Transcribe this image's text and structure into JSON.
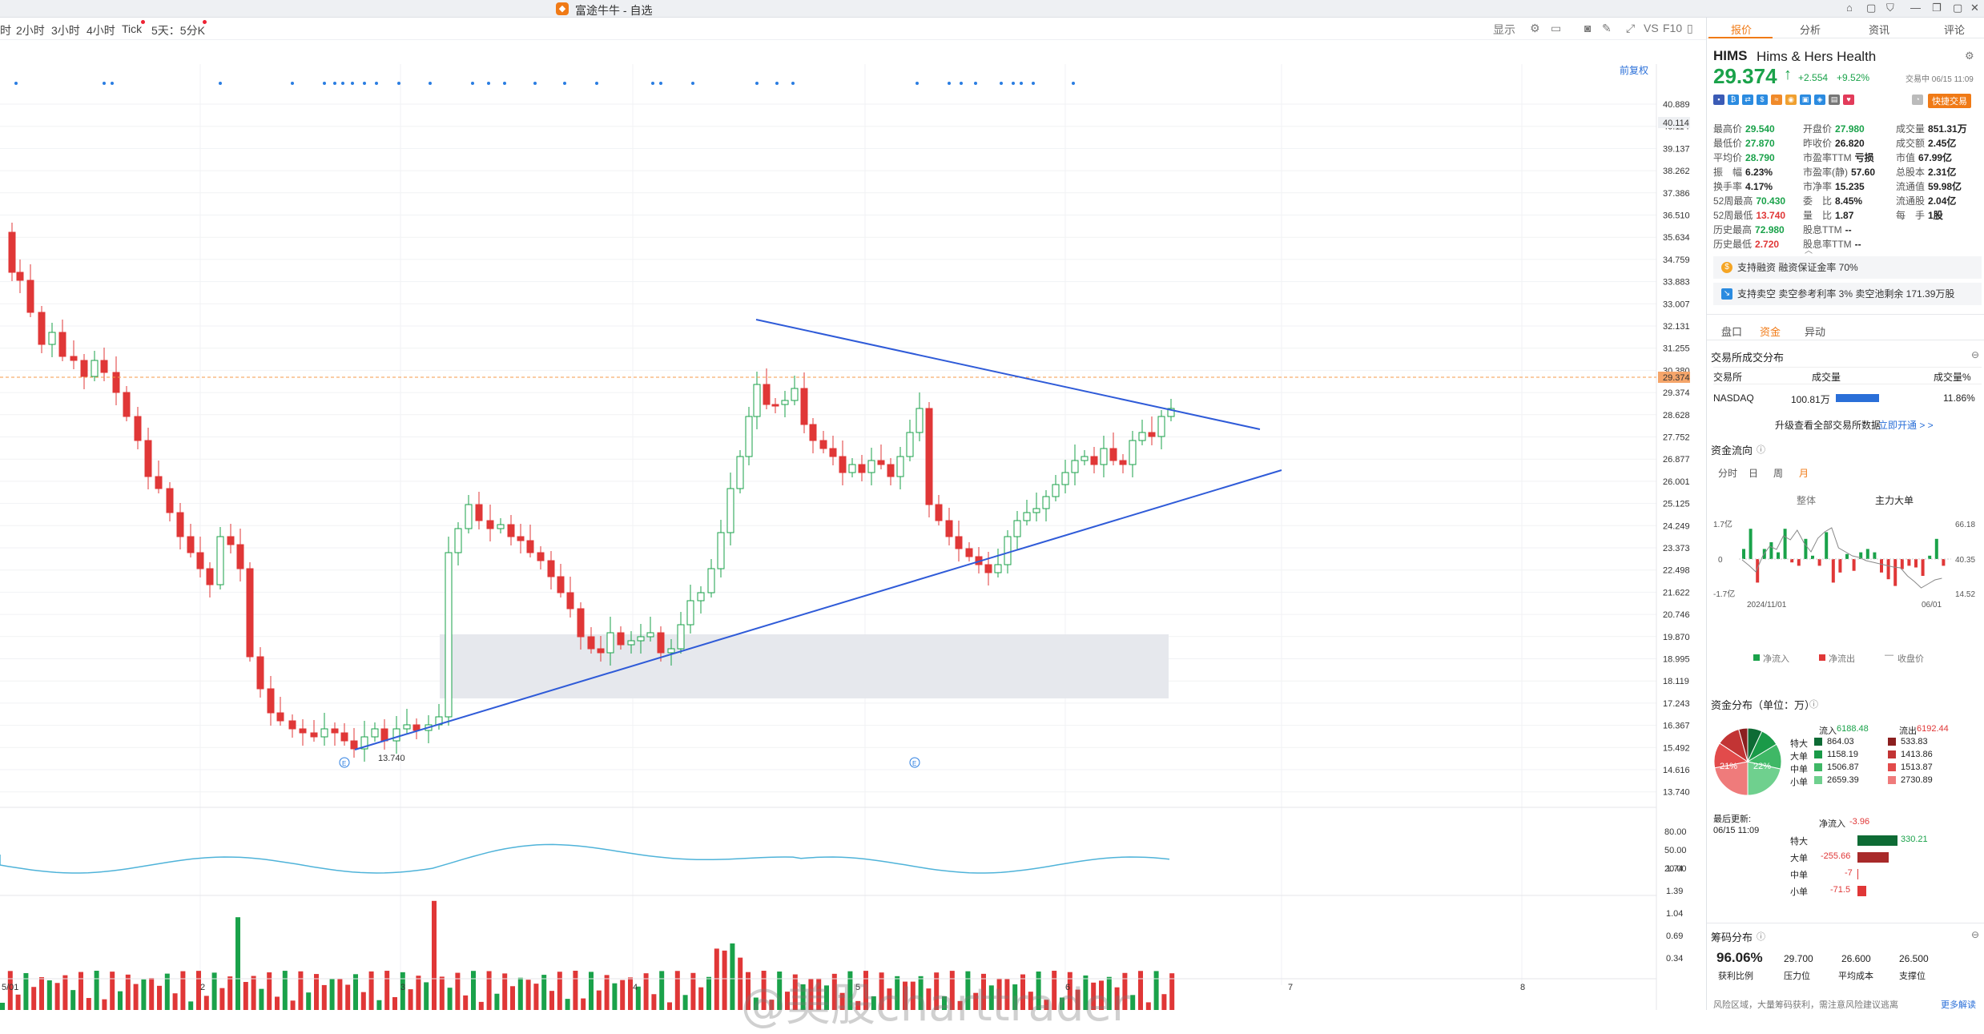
{
  "app": {
    "title": "富途牛牛 - 自选"
  },
  "toolbar": {
    "timeframes": [
      "时",
      "2小时",
      "3小时",
      "4小时",
      "Tick",
      "5天：5分K"
    ],
    "right_items": [
      "显示",
      "VS",
      "F10"
    ],
    "restore_label": "前复权"
  },
  "chart": {
    "price_ticks": [
      "40.889",
      "40.114",
      "39.137",
      "38.262",
      "37.386",
      "36.510",
      "35.634",
      "34.759",
      "33.883",
      "33.007",
      "32.131",
      "31.255",
      "30.380",
      "29.374",
      "28.628",
      "27.752",
      "26.877",
      "26.001",
      "25.125",
      "24.249",
      "23.373",
      "22.498",
      "21.622",
      "20.746",
      "19.870",
      "18.995",
      "18.119",
      "17.243",
      "16.367",
      "15.492",
      "14.616",
      "13.740"
    ],
    "current_price_label": "29.374",
    "top_price_label": "40.114",
    "low_annotation": "13.740",
    "event_marker": "E",
    "osc_ticks": [
      "80.00",
      "50.00",
      "20.00"
    ],
    "vol_ticks": [
      "1.74",
      "1.39",
      "1.04",
      "0.69",
      "0.34"
    ],
    "date_labels": [
      "5/01",
      "2",
      "3",
      "4",
      "5",
      "6",
      "7",
      "8"
    ],
    "watermark": "@美股charttrader"
  },
  "quote": {
    "tabs": [
      "报价",
      "分析",
      "资讯",
      "评论"
    ],
    "symbol": "HIMS",
    "name": "Hims & Hers Health",
    "price": "29.374",
    "arrow": "↑",
    "change": "+2.554",
    "change_pct": "+9.52%",
    "status": "交易中 06/15 11:09",
    "quick_trade": "快捷交易",
    "col1": [
      {
        "k": "最高价",
        "v": "29.540",
        "c": "green"
      },
      {
        "k": "最低价",
        "v": "27.870",
        "c": "green"
      },
      {
        "k": "平均价",
        "v": "28.790",
        "c": "green"
      },
      {
        "k": "振　幅",
        "v": "6.23%",
        "c": ""
      },
      {
        "k": "换手率",
        "v": "4.17%",
        "c": ""
      },
      {
        "k": "52周最高",
        "v": "70.430",
        "c": "green"
      },
      {
        "k": "52周最低",
        "v": "13.740",
        "c": "red"
      },
      {
        "k": "历史最高",
        "v": "72.980",
        "c": "green"
      },
      {
        "k": "历史最低",
        "v": "2.720",
        "c": "red"
      }
    ],
    "col2": [
      {
        "k": "开盘价",
        "v": "27.980",
        "c": "green"
      },
      {
        "k": "昨收价",
        "v": "26.820",
        "c": ""
      },
      {
        "k": "市盈率TTM",
        "v": "亏损",
        "c": ""
      },
      {
        "k": "市盈率(静)",
        "v": "57.60",
        "c": ""
      },
      {
        "k": "市净率",
        "v": "15.235",
        "c": ""
      },
      {
        "k": "委　比",
        "v": "8.45%",
        "c": ""
      },
      {
        "k": "量　比",
        "v": "1.87",
        "c": ""
      },
      {
        "k": "股息TTM",
        "v": "--",
        "c": ""
      },
      {
        "k": "股息率TTM",
        "v": "--",
        "c": ""
      }
    ],
    "col3": [
      {
        "k": "成交量",
        "v": "851.31万",
        "c": ""
      },
      {
        "k": "成交额",
        "v": "2.45亿",
        "c": ""
      },
      {
        "k": "市值",
        "v": "67.99亿",
        "c": ""
      },
      {
        "k": "总股本",
        "v": "2.31亿",
        "c": ""
      },
      {
        "k": "流通值",
        "v": "59.98亿",
        "c": ""
      },
      {
        "k": "流通股",
        "v": "2.04亿",
        "c": ""
      },
      {
        "k": "每　手",
        "v": "1股",
        "c": ""
      }
    ],
    "margin_info": "支持融资  融资保证金率 70%",
    "short_info": "支持卖空  卖空参考利率 3%  卖空池剩余 171.39万股"
  },
  "capital": {
    "tabs": [
      "盘口",
      "资金",
      "异动"
    ],
    "exchange_title": "交易所成交分布",
    "exchange_headers": [
      "交易所",
      "成交量",
      "成交量%"
    ],
    "exchange_row": {
      "name": "NASDAQ",
      "volume": "100.81万",
      "pct": "11.86%"
    },
    "upgrade_text": "升级查看全部交易所数据",
    "upgrade_link": "立即开通 > >",
    "flow_title": "资金流向",
    "flow_periods": [
      "分时",
      "日",
      "周",
      "月"
    ],
    "flow_subtabs": [
      "整体",
      "主力大单"
    ],
    "flow_left_ticks": [
      "1.7亿",
      "0",
      "-1.7亿"
    ],
    "flow_right_ticks": [
      "66.18",
      "40.35",
      "14.52"
    ],
    "flow_dates": [
      "2024/11/01",
      "06/01"
    ],
    "flow_legend": [
      "净流入",
      "净流出",
      "收盘价"
    ],
    "flow_values": [
      0.3,
      0.9,
      -0.7,
      0.3,
      0.5,
      0.2,
      0.9,
      -0.1,
      -0.2,
      0.6,
      0.1,
      -0.2,
      0.8,
      -0.7,
      -0.4,
      0.15,
      -0.35,
      0.2,
      0.3,
      0.2,
      -0.4,
      -0.6,
      -0.8,
      -0.3,
      -0.2,
      -0.25,
      -0.5,
      0.1,
      0.6,
      -0.2
    ],
    "close_values": [
      0.45,
      0.38,
      0.3,
      0.5,
      0.62,
      0.58,
      0.75,
      0.7,
      0.82,
      0.66,
      0.55,
      0.72,
      0.8,
      0.85,
      0.6,
      0.55,
      0.5,
      0.48,
      0.44,
      0.42,
      0.4,
      0.38,
      0.36,
      0.35,
      0.25,
      0.18,
      0.1,
      0.15,
      0.2,
      0.22
    ],
    "dist_title": "资金分布（单位：万）",
    "inflow_label": "流入",
    "inflow_total": "6188.48",
    "outflow_label": "流出",
    "outflow_total": "6192.44",
    "dist_rows": [
      {
        "label": "特大",
        "in": "864.03",
        "out": "533.83",
        "in_color": "#0e6b35",
        "out_color": "#8b1f1f"
      },
      {
        "label": "大单",
        "in": "1158.19",
        "out": "1413.86",
        "in_color": "#1a9a48",
        "out_color": "#c23434"
      },
      {
        "label": "中单",
        "in": "1506.87",
        "out": "1513.87",
        "in_color": "#3fb866",
        "out_color": "#e24b4b"
      },
      {
        "label": "小单",
        "in": "2659.39",
        "out": "2730.89",
        "in_color": "#6fd08e",
        "out_color": "#ef7b7b"
      }
    ],
    "pie_in_label": "21%",
    "pie_out_label": "22%",
    "last_update_label": "最后更新:",
    "last_update": "06/15 11:09",
    "net_label": "净流入",
    "net_value": "-3.96",
    "net_rows": [
      {
        "label": "特大",
        "value": "330.21",
        "num": 330.21
      },
      {
        "label": "大单",
        "value": "-255.66",
        "num": -255.66
      },
      {
        "label": "中单",
        "value": "-7",
        "num": -7
      },
      {
        "label": "小单",
        "value": "-71.5",
        "num": -71.5
      }
    ],
    "chip_title": "筹码分布",
    "chip_items": [
      {
        "value": "96.06%",
        "label": "获利比例"
      },
      {
        "value": "29.700",
        "label": "压力位"
      },
      {
        "value": "26.600",
        "label": "平均成本"
      },
      {
        "value": "26.500",
        "label": "支撑位"
      }
    ],
    "chip_note": "风险区域，大量筹码获利，需注意风险建议逃离",
    "more_link": "更多解读"
  }
}
